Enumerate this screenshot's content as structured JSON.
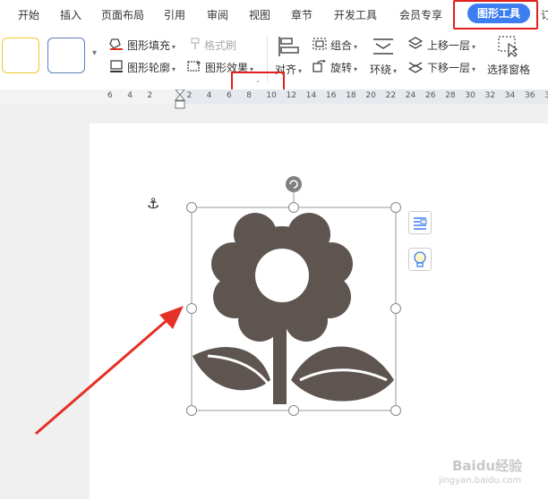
{
  "tabs": [
    {
      "label": "开始"
    },
    {
      "label": "插入"
    },
    {
      "label": "页面布局"
    },
    {
      "label": "引用"
    },
    {
      "label": "审阅"
    },
    {
      "label": "视图"
    },
    {
      "label": "章节"
    },
    {
      "label": "开发工具"
    },
    {
      "label": "会员专享"
    },
    {
      "label": "图形工具"
    },
    {
      "label": "订"
    }
  ],
  "active_tab": "图形工具",
  "ribbon": {
    "fill": "图形填充",
    "outline": "图形轮廓",
    "format_painter": "格式刷",
    "effect": "图形效果",
    "align": "对齐",
    "group": "组合",
    "rotate": "旋转",
    "wrap": "环绕",
    "bring_forward": "上移一层",
    "send_backward": "下移一层",
    "selection_pane": "选择窗格"
  },
  "ruler_ticks": [
    "6",
    "4",
    "2",
    "2",
    "4",
    "6",
    "8",
    "10",
    "12",
    "14",
    "16",
    "18",
    "20",
    "22",
    "24",
    "26",
    "28",
    "30",
    "32",
    "34",
    "36",
    "38"
  ],
  "colors": {
    "accent": "#3c7ef0",
    "highlight": "#e0201c",
    "shape_fill": "#5e5550",
    "arrow": "#e53025"
  },
  "shape": {
    "name": "flower-icon",
    "selected": true
  },
  "watermark": {
    "text": "Baidu经验",
    "url": "jingyan.baidu.com"
  }
}
